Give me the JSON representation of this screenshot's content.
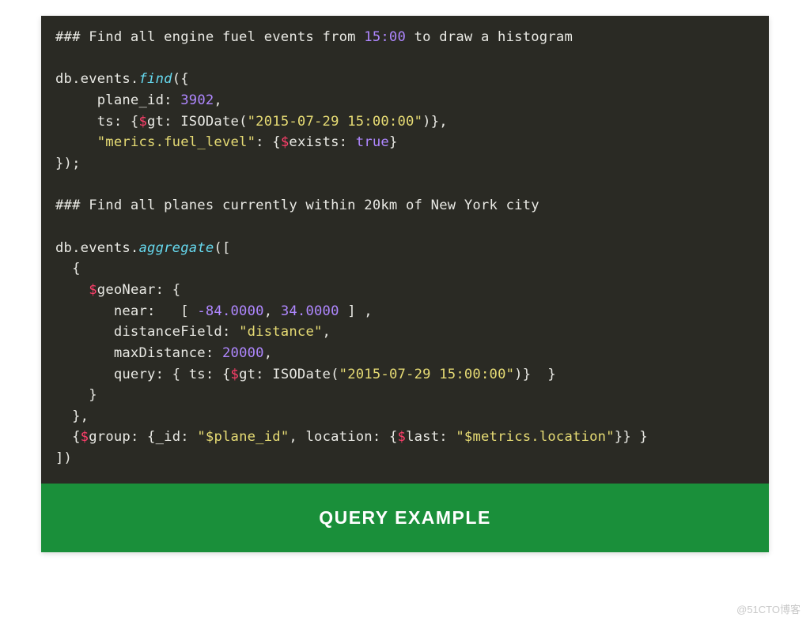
{
  "code": {
    "comment1_prefix": "### Find all engine fuel events from ",
    "comment1_time": "15:00",
    "comment1_suffix": " to draw a histogram",
    "q1_l1a": "db.events.",
    "q1_l1b": "find",
    "q1_l1c": "({",
    "q1_l2a": "     plane_id: ",
    "q1_l2b": "3902",
    "q1_l2c": ",",
    "q1_l3a": "     ts: {",
    "q1_l3b": "$",
    "q1_l3c": "gt: ISODate(",
    "q1_l3d": "\"2015-07-29 15:00:00\"",
    "q1_l3e": ")},",
    "q1_l4a": "     ",
    "q1_l4b": "\"merics.fuel_level\"",
    "q1_l4c": ": {",
    "q1_l4d": "$",
    "q1_l4e": "exists: ",
    "q1_l4f": "true",
    "q1_l4g": "}",
    "q1_l5": "});",
    "comment2": "### Find all planes currently within 20km of New York city",
    "q2_l1a": "db.events.",
    "q2_l1b": "aggregate",
    "q2_l1c": "([",
    "q2_l2": "  {",
    "q2_l3a": "    ",
    "q2_l3b": "$",
    "q2_l3c": "geoNear: {",
    "q2_l4a": "       near:   [ ",
    "q2_l4b": "-84.0000",
    "q2_l4c": ", ",
    "q2_l4d": "34.0000",
    "q2_l4e": " ] ,",
    "q2_l5a": "       distanceField: ",
    "q2_l5b": "\"distance\"",
    "q2_l5c": ",",
    "q2_l6a": "       maxDistance: ",
    "q2_l6b": "20000",
    "q2_l6c": ",",
    "q2_l7a": "       query: { ts: {",
    "q2_l7b": "$",
    "q2_l7c": "gt: ISODate(",
    "q2_l7d": "\"2015-07-29 15:00:00\"",
    "q2_l7e": ")}  }",
    "q2_l8": "    }",
    "q2_l9": "  },",
    "q2_l10a": "  {",
    "q2_l10b": "$",
    "q2_l10c": "group: {_id: ",
    "q2_l10d": "\"$plane_id\"",
    "q2_l10e": ", location: {",
    "q2_l10f": "$",
    "q2_l10g": "last: ",
    "q2_l10h": "\"$metrics.location\"",
    "q2_l10i": "}} }",
    "q2_l11": "])"
  },
  "banner_text": "QUERY EXAMPLE",
  "watermark": "@51CTO博客"
}
